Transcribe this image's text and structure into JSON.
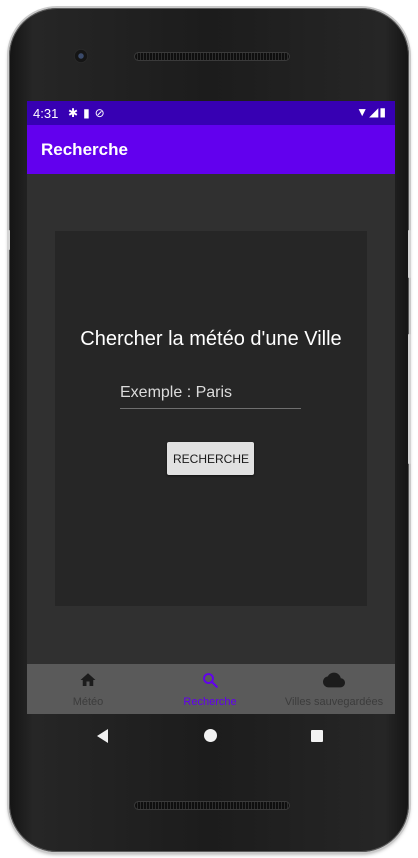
{
  "status_bar": {
    "time": "4:31",
    "left_icons": [
      "gear-icon",
      "sd-card-icon",
      "do-not-disturb-icon"
    ],
    "right_icons": [
      "wifi-icon",
      "signal-icon",
      "battery-icon"
    ]
  },
  "app_bar": {
    "title": "Recherche",
    "color": "#6200ee"
  },
  "search": {
    "heading": "Chercher la météo d'une Ville",
    "input_placeholder": "Exemple : Paris",
    "input_value": "",
    "button_label": "RECHERCHE"
  },
  "bottom_nav": {
    "items": [
      {
        "label": "Météo",
        "icon": "home-icon",
        "active": false
      },
      {
        "label": "Recherche",
        "icon": "search-icon",
        "active": true
      },
      {
        "label": "Villes sauvegardées",
        "icon": "cloud-icon",
        "active": false
      }
    ],
    "active_color": "#6200ee"
  },
  "system_nav": [
    "back-icon",
    "home-circle-icon",
    "recents-icon"
  ],
  "colors": {
    "status_bar": "#3700b3",
    "background": "#303030",
    "panel": "#262626"
  }
}
